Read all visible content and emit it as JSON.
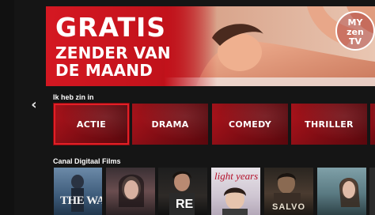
{
  "banner": {
    "headline": "GRATIS",
    "subline_1": "ZENDER VAN",
    "subline_2": "DE MAAND",
    "logo": {
      "line_1": "MY",
      "line_2": "zen",
      "line_3": "TV"
    },
    "accent_color": "#d51822"
  },
  "navigation": {
    "previous_icon": "chevron-left-icon",
    "previous_glyph": "‹"
  },
  "genre_section": {
    "title": "Ik heb zin in",
    "tiles": [
      {
        "label": "ACTIE",
        "focused": true
      },
      {
        "label": "DRAMA",
        "focused": false
      },
      {
        "label": "COMEDY",
        "focused": false
      },
      {
        "label": "THRILLER",
        "focused": false
      }
    ]
  },
  "films_section": {
    "title": "Canal Digitaal Films",
    "posters": [
      {
        "title": "THE WALL"
      },
      {
        "title": ""
      },
      {
        "title": "RE"
      },
      {
        "title": "light years"
      },
      {
        "title": "SALVO"
      },
      {
        "title": ""
      }
    ]
  }
}
